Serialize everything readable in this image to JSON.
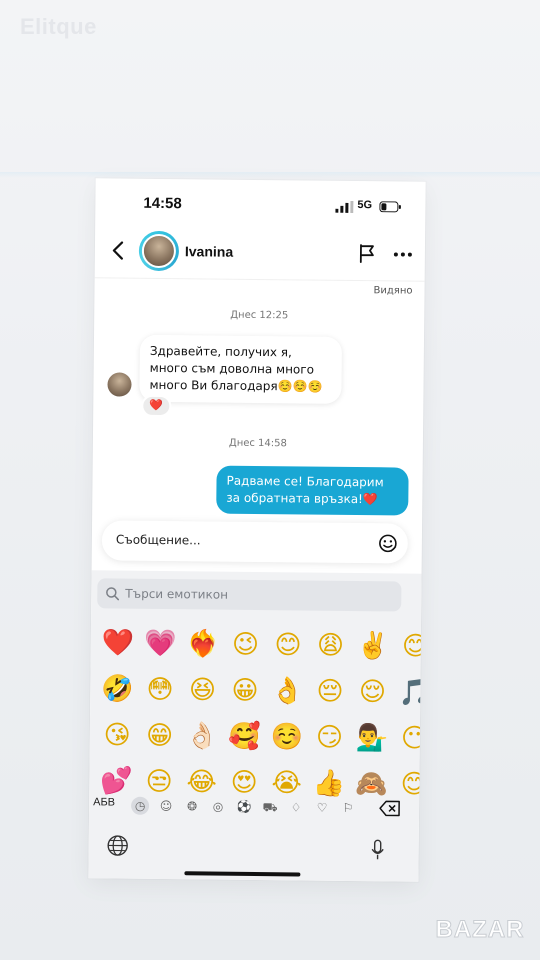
{
  "watermark": "Elitque",
  "status_bar": {
    "time": "14:58",
    "network": "5G"
  },
  "header": {
    "contact_name": "Ivanina"
  },
  "chat": {
    "seen_label": "Видяно",
    "timestamp_1": "Днес 12:25",
    "incoming_message": "Здравейте, получих я, много съм доволна много много Ви благодаря☺️☺️☺️",
    "reaction": "❤️",
    "timestamp_2": "Днес 14:58",
    "outgoing_message": "Радваме се! Благодарим за обратната връзка!❤️"
  },
  "composer": {
    "placeholder": "Съобщение..."
  },
  "emoji_keyboard": {
    "search_placeholder": "Търси емотикон",
    "rows": [
      [
        "❤️",
        "💗",
        "❤️‍🔥",
        "😉",
        "😊",
        "😩",
        "✌️",
        "😊"
      ],
      [
        "🤣",
        "😳",
        "😆",
        "😀",
        "👌",
        "😔",
        "😌",
        "🎵"
      ],
      [
        "😘",
        "😁",
        "👌🏻",
        "🥰",
        "☺️",
        "😏",
        "💁‍♂️",
        "😶"
      ],
      [
        "💕",
        "😒",
        "😂",
        "😍",
        "😭",
        "👍",
        "🙈",
        "😊"
      ]
    ],
    "abc_label": "АБВ",
    "category_icons": [
      "recent-icon",
      "smiley-icon",
      "animal-icon",
      "food-icon",
      "ball-icon",
      "car-icon",
      "lightbulb-icon",
      "heart-icon",
      "flag-icon"
    ]
  },
  "logo": "BAZAR"
}
